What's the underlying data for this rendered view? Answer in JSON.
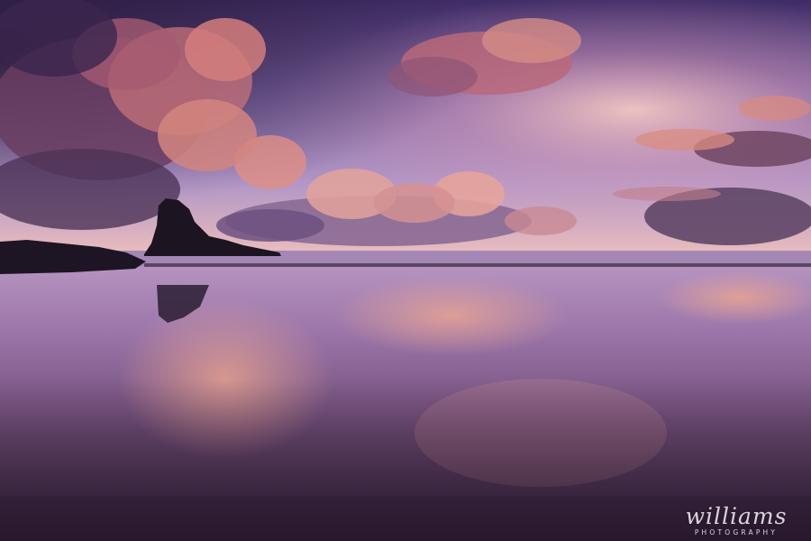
{
  "watermark": {
    "name": "williams",
    "subtitle": "PHOTOGRAPHY"
  },
  "palette": {
    "sky_top": "#4a3470",
    "sky_mid": "#9a7cb8",
    "horizon_glow": "#f2b5a8",
    "cloud_pink": "#e08878",
    "cloud_shadow": "#5a3a5e",
    "sand_dark": "#2e1e34",
    "silhouette": "#1c1420"
  },
  "scene": {
    "subject": "sea stack silhouette at sunset",
    "icons": [
      "sea-stack-silhouette",
      "cloud-bank",
      "wet-sand-reflection"
    ]
  }
}
